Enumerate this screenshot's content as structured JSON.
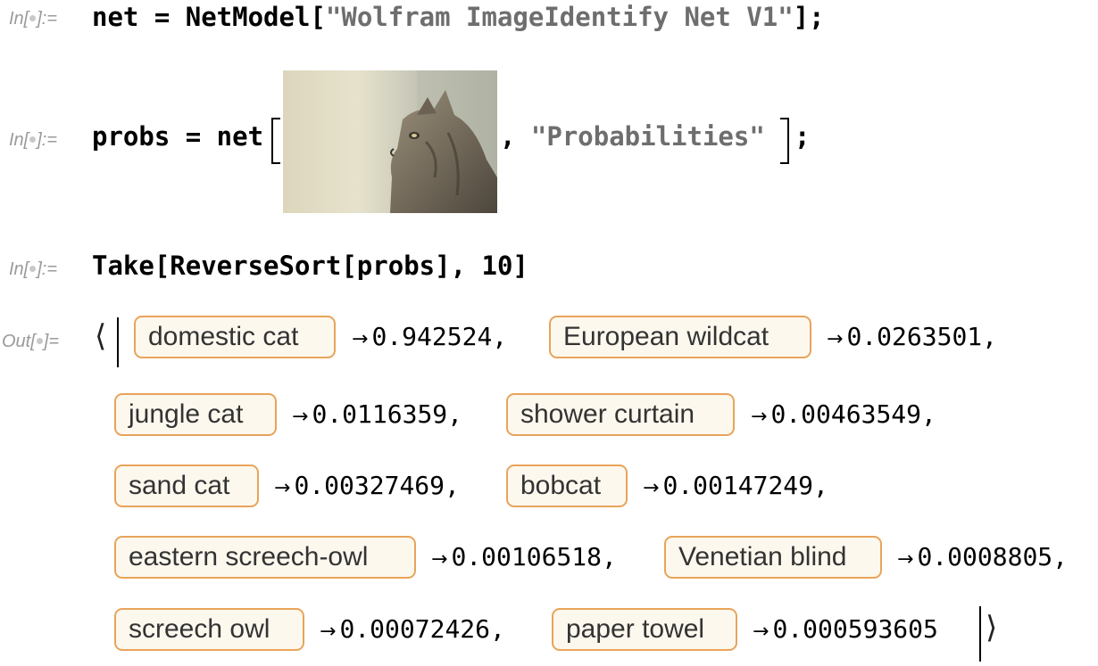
{
  "cells": {
    "in1": {
      "label_pre": "In[",
      "label_post": "]:=",
      "code_prefix": "net = NetModel[",
      "string": "\"Wolfram ImageIdentify Net V1\"",
      "code_suffix": "];"
    },
    "in2": {
      "label_pre": "In[",
      "label_post": "]:=",
      "code_prefix": "probs = net",
      "comma": ", ",
      "string": "\"Probabilities\"",
      "code_suffix": ";"
    },
    "in3": {
      "label_pre": "In[",
      "label_post": "]:=",
      "code": "Take[ReverseSort[probs], 10]"
    },
    "out": {
      "label_pre": "Out[",
      "label_post": "]="
    }
  },
  "results": [
    {
      "name": "domestic cat",
      "value": "0.942524,"
    },
    {
      "name": "European wildcat",
      "value": "0.0263501,"
    },
    {
      "name": "jungle cat",
      "value": "0.0116359,"
    },
    {
      "name": "shower curtain",
      "value": "0.00463549,"
    },
    {
      "name": "sand cat",
      "value": "0.00327469,"
    },
    {
      "name": "bobcat",
      "value": "0.00147249,"
    },
    {
      "name": "eastern screech-owl",
      "value": "0.00106518,"
    },
    {
      "name": "Venetian blind",
      "value": "0.0008805,"
    },
    {
      "name": "screech owl",
      "value": "0.00072426,"
    },
    {
      "name": "paper towel",
      "value": "0.000593605"
    }
  ],
  "symbols": {
    "arrow": "→",
    "open_angle": "⟨",
    "close_angle": "⟩"
  },
  "colors": {
    "entity_border": "#e8a45a",
    "entity_bg": "#fdf8ee",
    "string": "#6e6e6e",
    "label": "#9a9a9a"
  }
}
